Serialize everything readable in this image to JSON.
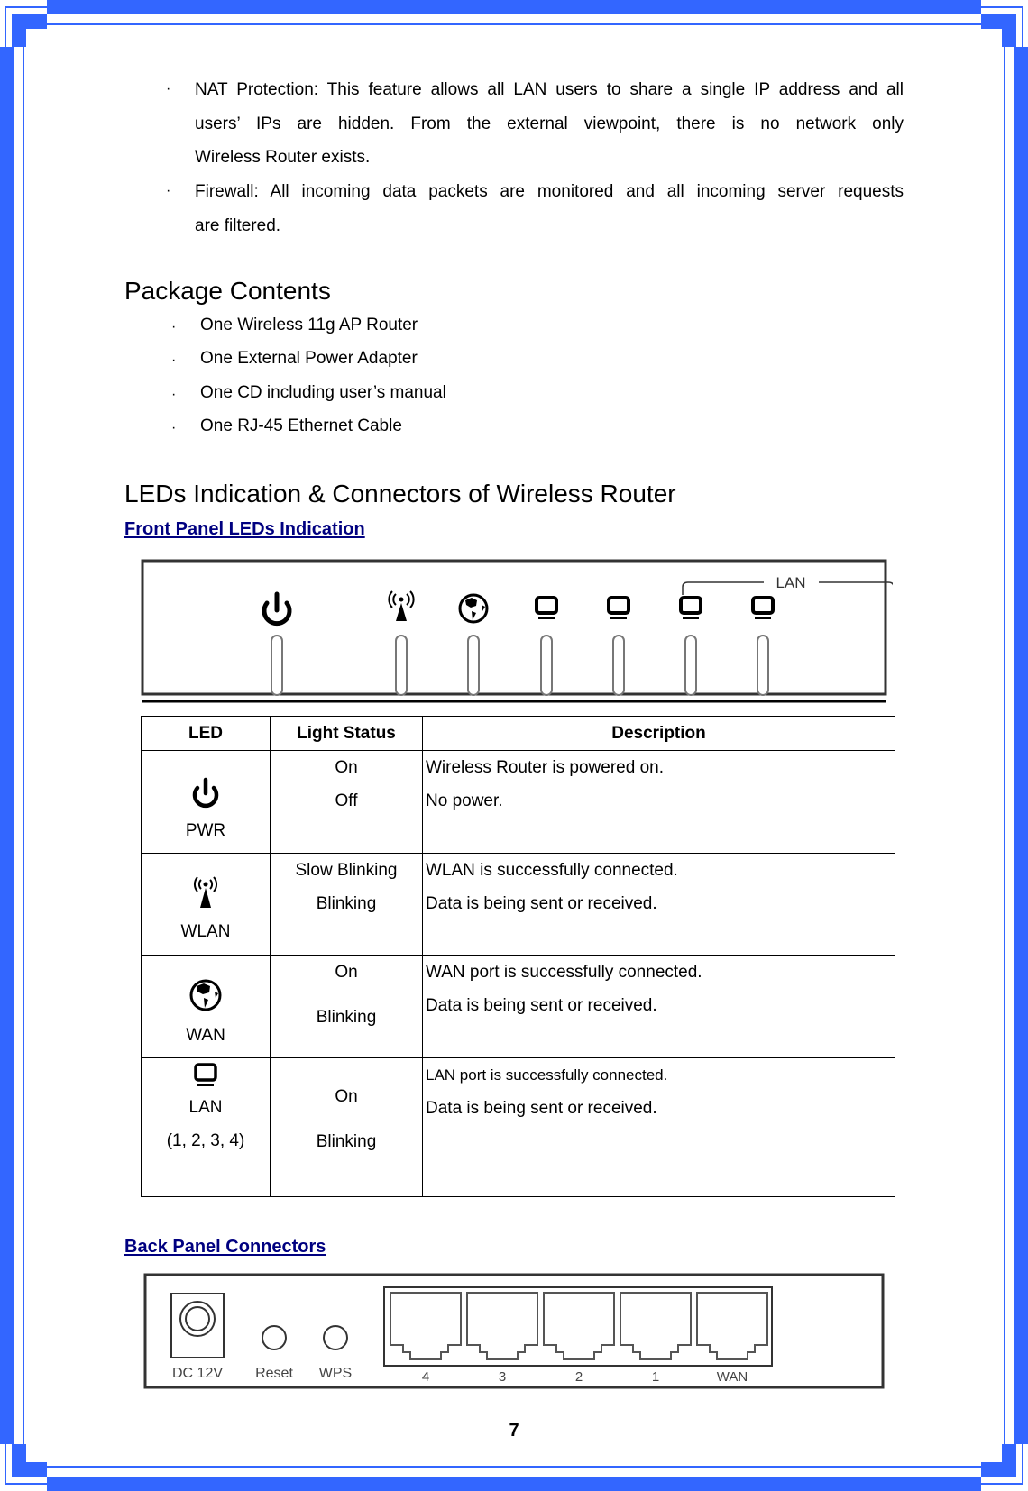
{
  "page": {
    "frame_color": "#3366ff",
    "link_color": "#000080",
    "page_number": "7"
  },
  "features": [
    {
      "bullet": "·",
      "lines": [
        "NAT Protection: This feature allows all LAN users to share a single IP address and all",
        "users’ IPs are hidden.  From the external viewpoint, there is no network only",
        "Wireless Router exists."
      ]
    },
    {
      "bullet": "·",
      "lines": [
        "Firewall: All incoming data packets are monitored and all incoming server requests",
        "are filtered."
      ]
    }
  ],
  "package": {
    "title": "Package Contents",
    "items": [
      "One Wireless 11g AP Router",
      "One External Power Adapter",
      "One CD including user’s manual",
      "One RJ-45 Ethernet Cable"
    ]
  },
  "leds_section": {
    "title": "LEDs Indication & Connectors of Wireless Router",
    "front_panel_title": "Front Panel LEDs Indication",
    "front_panel_figure": {
      "group_label": "LAN",
      "leds": [
        "power-icon",
        "wlan-antenna-icon",
        "globe-icon",
        "lan-monitor-icon",
        "lan-monitor-icon",
        "lan-monitor-icon",
        "lan-monitor-icon"
      ]
    },
    "table": {
      "headers": [
        "LED",
        "Light Status",
        "Description"
      ],
      "rows": [
        {
          "icon": "power-icon",
          "led": [
            "PWR"
          ],
          "status": [
            "On",
            "Off"
          ],
          "description": [
            "Wireless Router is powered on.",
            "No power."
          ]
        },
        {
          "icon": "wlan-antenna-icon",
          "led": [
            "WLAN"
          ],
          "status": [
            "Slow Blinking",
            "Blinking"
          ],
          "description": [
            "WLAN is successfully connected.",
            "Data is being sent or received."
          ]
        },
        {
          "icon": "globe-icon",
          "led": [
            "WAN"
          ],
          "status": [
            "On",
            "Blinking"
          ],
          "description": [
            "WAN port is successfully connected.",
            "Data is being sent or received."
          ]
        },
        {
          "icon": "lan-monitor-icon",
          "led": [
            "LAN",
            "(1, 2, 3, 4)"
          ],
          "status": [
            "On",
            "Blinking"
          ],
          "description": [
            "LAN port is successfully connected.",
            "Data is being sent or received."
          ]
        }
      ]
    },
    "back_panel_title": "Back Panel Connectors",
    "back_panel_figure": {
      "labels": [
        "DC 12V",
        "Reset",
        "WPS"
      ],
      "ports": [
        "4",
        "3",
        "2",
        "1",
        "WAN"
      ]
    }
  }
}
